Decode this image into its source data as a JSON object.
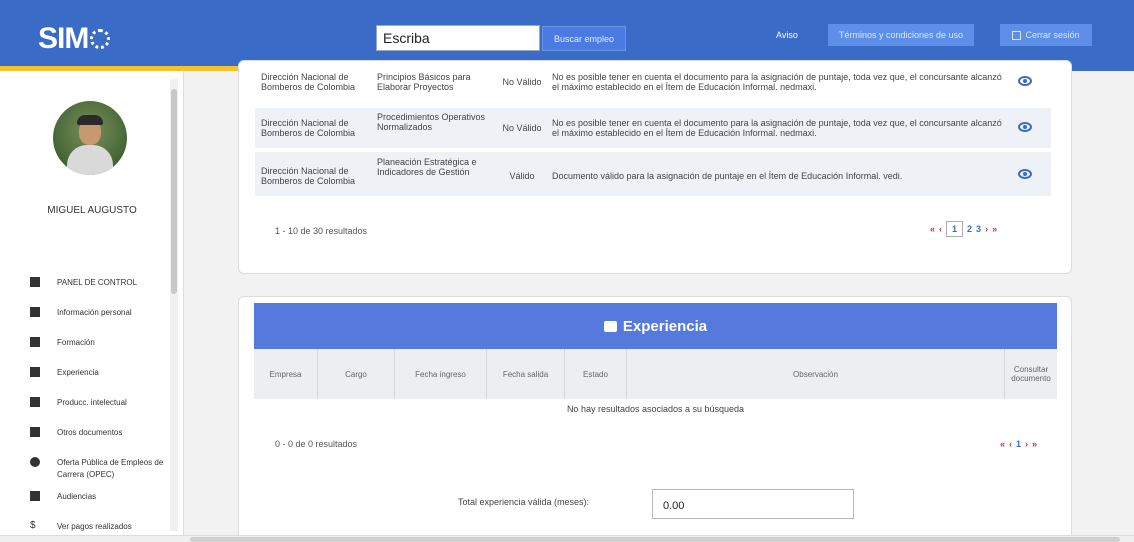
{
  "header": {
    "logo_text": "SIMO",
    "search_value": "Escriba",
    "search_button": "Buscar empleo",
    "aviso": "Aviso",
    "terms_button": "Términos y condiciones de uso",
    "logout_button": "Cerrar sesión",
    "colors": {
      "primary": "#3a6bc6",
      "stripe_yellow": "#f3c22c",
      "stripe_red": "#d9343d"
    }
  },
  "sidebar": {
    "user_name": "MIGUEL AUGUSTO",
    "items": [
      {
        "label": "PANEL DE CONTROL",
        "icon": "dashboard-icon"
      },
      {
        "label": "Información personal",
        "icon": "people-icon"
      },
      {
        "label": "Formación",
        "icon": "graduation-icon"
      },
      {
        "label": "Experiencia",
        "icon": "briefcase-icon"
      },
      {
        "label": "Producc. intelectual",
        "icon": "book-icon"
      },
      {
        "label": "Otros documentos",
        "icon": "document-icon"
      },
      {
        "label": "Oferta Pública de Empleos de Carrera (OPEC)",
        "icon": "globe-icon"
      },
      {
        "label": "Audiencias",
        "icon": "audience-icon"
      },
      {
        "label": "Ver pagos realizados",
        "icon": "dollar-icon"
      }
    ]
  },
  "education_table": {
    "rows": [
      {
        "institution": "Dirección Nacional de Bomberos de Colombia",
        "course": "Principios Básicos para Elaborar Proyectos",
        "status": "No Válido",
        "observation": "No es posible tener en cuenta el documento para la asignación de puntaje, toda vez que, el concursante alcanzó el máximo establecido en el Ítem de Educación Informal. nedmaxi."
      },
      {
        "institution": "Dirección Nacional de Bomberos de Colombia",
        "course": "Procedimientos Operativos Normalizados",
        "status": "No Válido",
        "observation": "No es posible tener en cuenta el documento para la asignación de puntaje, toda vez que, el concursante alcanzó el máximo establecido en el Ítem de Educación Informal. nedmaxi."
      },
      {
        "institution": "Dirección Nacional de Bomberos de Colombia",
        "course": "Planeación Estratégica e Indicadores de Gestión",
        "status": "Válido",
        "observation": "Documento válido para la asignación de puntaje en el Ítem de Educación Informal. vedi."
      }
    ],
    "pager_text": "1 - 10 de 30 resultados",
    "pager": {
      "first": "«",
      "prev": "‹",
      "pages": [
        "1",
        "2",
        "3"
      ],
      "current": "1",
      "next": "›",
      "last": "»"
    }
  },
  "experience": {
    "title": "Experiencia",
    "columns": [
      "Empresa",
      "Cargo",
      "Fecha ingreso",
      "Fecha salida",
      "Estado",
      "Observación",
      "Consultar documento"
    ],
    "no_results": "No hay resultados asociados a su búsqueda",
    "pager_text": "0 - 0 de 0 resultados",
    "pager": {
      "first": "«",
      "prev": "‹",
      "page": "1",
      "next": "›",
      "last": "»"
    },
    "total_label": "Total experiencia válida (meses):",
    "total_value": "0.00"
  }
}
